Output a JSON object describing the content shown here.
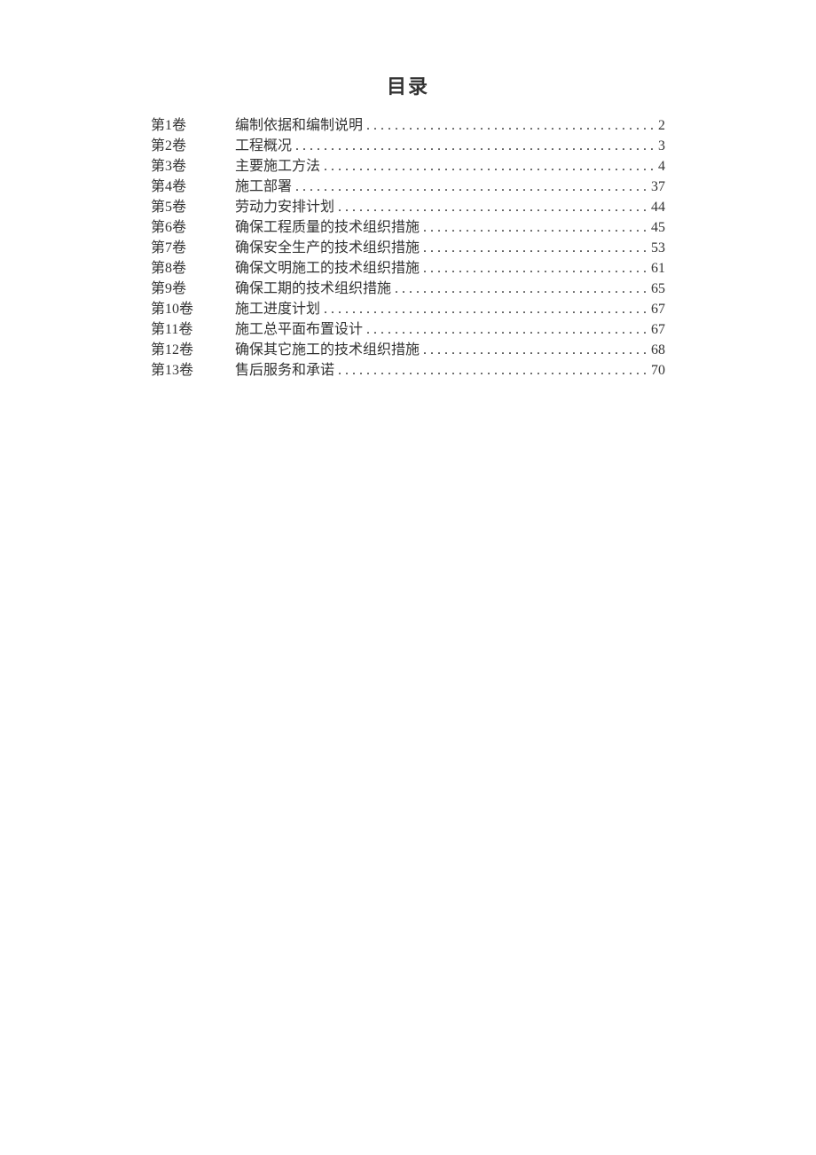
{
  "title": "目录",
  "toc": {
    "items": [
      {
        "volume": "第1卷",
        "title": "编制依据和编制说明",
        "page": "2"
      },
      {
        "volume": "第2卷",
        "title": "工程概况",
        "page": "3"
      },
      {
        "volume": "第3卷",
        "title": "主要施工方法",
        "page": "4"
      },
      {
        "volume": "第4卷",
        "title": "施工部署",
        "page": "37"
      },
      {
        "volume": "第5卷",
        "title": "劳动力安排计划",
        "page": "44"
      },
      {
        "volume": "第6卷",
        "title": "确保工程质量的技术组织措施",
        "page": "45"
      },
      {
        "volume": "第7卷",
        "title": "确保安全生产的技术组织措施",
        "page": "53"
      },
      {
        "volume": "第8卷",
        "title": "确保文明施工的技术组织措施",
        "page": "61"
      },
      {
        "volume": "第9卷",
        "title": "确保工期的技术组织措施",
        "page": "65"
      },
      {
        "volume": "第10卷",
        "title": "施工进度计划",
        "page": "67"
      },
      {
        "volume": "第11卷",
        "title": "施工总平面布置设计",
        "page": "67"
      },
      {
        "volume": "第12卷",
        "title": "确保其它施工的技术组织措施",
        "page": "68"
      },
      {
        "volume": "第13卷",
        "title": "售后服务和承诺",
        "page": "70"
      }
    ]
  }
}
